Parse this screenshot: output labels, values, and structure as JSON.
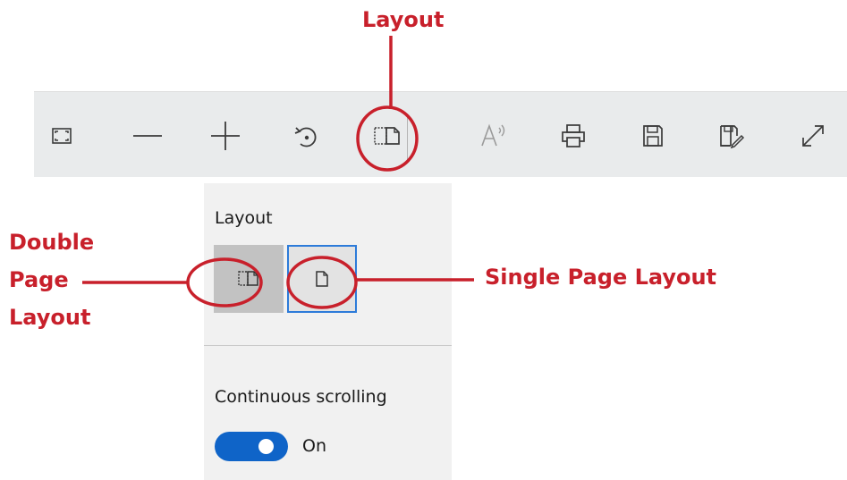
{
  "annotations": {
    "layout": "Layout",
    "double_line1": "Double",
    "double_line2": "Page",
    "double_line3": "Layout",
    "single": "Single Page Layout"
  },
  "toolbar": {
    "buttons": [
      {
        "icon": "fit-to-page-icon"
      },
      {
        "icon": "zoom-out-icon"
      },
      {
        "icon": "zoom-in-icon"
      },
      {
        "icon": "rotate-icon"
      },
      {
        "icon": "page-layout-icon"
      },
      {
        "icon": "read-aloud-icon"
      },
      {
        "icon": "print-icon"
      },
      {
        "icon": "save-icon"
      },
      {
        "icon": "save-as-icon"
      },
      {
        "icon": "full-screen-icon"
      }
    ]
  },
  "flyout": {
    "layout_heading": "Layout",
    "scrolling_heading": "Continuous scrolling",
    "toggle_state": "On",
    "options": [
      {
        "name": "double-page",
        "selected": false
      },
      {
        "name": "single-page",
        "selected": true
      }
    ]
  },
  "colors": {
    "annotation": "#c8202b",
    "toggle_on": "#0f64c8",
    "selection_border": "#2d7bd9",
    "toolbar_bg": "#e9ebec",
    "flyout_bg": "#f1f1f1"
  }
}
